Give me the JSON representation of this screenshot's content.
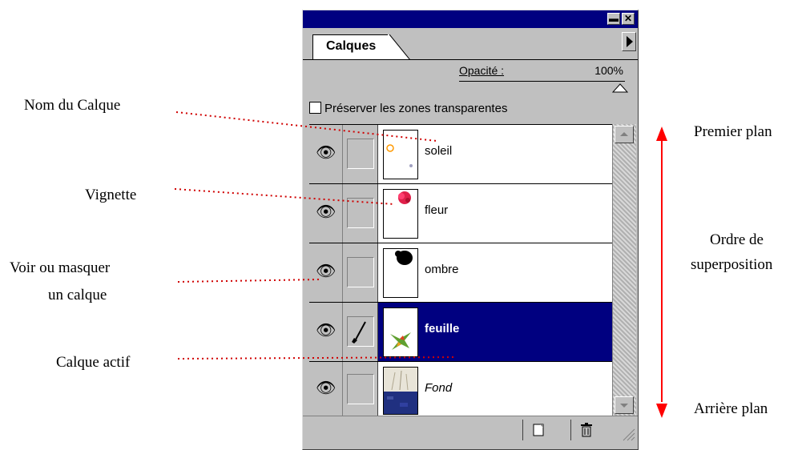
{
  "annotations": {
    "nom_du_calque": "Nom du Calque",
    "vignette": "Vignette",
    "voir_masquer_1": "Voir ou masquer",
    "voir_masquer_2": "un calque",
    "calque_actif": "Calque actif",
    "premier_plan": "Premier plan",
    "ordre_1": "Ordre de",
    "ordre_2": "superposition",
    "arriere_plan": "Arrière plan"
  },
  "palette": {
    "tab_label": "Calques",
    "opacity_label": "Opacité :",
    "opacity_value": "100%",
    "preserve_label": "Préserver les zones transparentes",
    "layers": [
      {
        "name": "soleil",
        "active": false,
        "visible": true
      },
      {
        "name": "fleur",
        "active": false,
        "visible": true
      },
      {
        "name": "ombre",
        "active": false,
        "visible": true
      },
      {
        "name": "feuille",
        "active": true,
        "visible": true
      },
      {
        "name": "Fond",
        "active": false,
        "visible": true
      }
    ]
  },
  "colors": {
    "title_bar": "#000080",
    "active_layer": "#000080",
    "annotation_dots": "#d00000",
    "order_arrow": "#ff0000"
  }
}
